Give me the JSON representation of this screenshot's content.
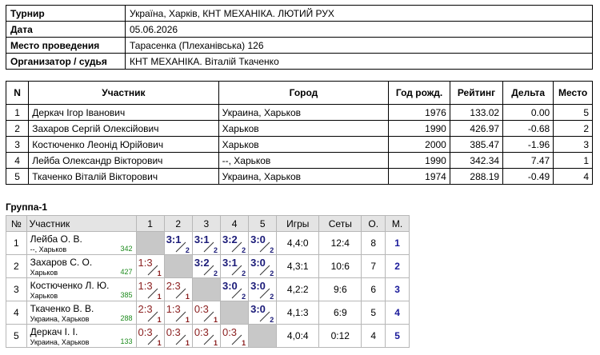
{
  "info": [
    {
      "label": "Турнир",
      "value": "Україна, Харків, КНТ МЕХАНІКА. ЛЮТИЙ РУХ"
    },
    {
      "label": "Дата",
      "value": "05.06.2026"
    },
    {
      "label": "Место проведения",
      "value": "Тарасенка (Плеханівська) 126"
    },
    {
      "label": "Организатор / судья",
      "value": "КНТ МЕХАНІКА. Віталій Ткаченко"
    }
  ],
  "participants": {
    "headers": [
      "N",
      "Участник",
      "Город",
      "Год рожд.",
      "Рейтинг",
      "Дельта",
      "Место"
    ],
    "rows": [
      [
        "1",
        "Деркач Ігор Іванович",
        "Украина, Харьков",
        "1976",
        "133.02",
        "0.00",
        "5"
      ],
      [
        "2",
        "Захаров Сергій Олексійович",
        "Харьков",
        "1990",
        "426.97",
        "-0.68",
        "2"
      ],
      [
        "3",
        "Костюченко Леонід Юрійович",
        "Харьков",
        "2000",
        "385.47",
        "-1.96",
        "3"
      ],
      [
        "4",
        "Лейба Олександр Вікторович",
        "--, Харьков",
        "1990",
        "342.34",
        "7.47",
        "1"
      ],
      [
        "5",
        "Ткаченко Віталій Вікторович",
        "Украина, Харьков",
        "1974",
        "288.19",
        "-0.49",
        "4"
      ]
    ]
  },
  "group": {
    "title": "Группа-1",
    "headers": [
      "№",
      "Участник",
      "1",
      "2",
      "3",
      "4",
      "5",
      "Игры",
      "Сеты",
      "О.",
      "М."
    ],
    "rows": [
      {
        "n": "1",
        "name": "Лейба О. В.",
        "city": "--, Харьков",
        "rating": "342",
        "results": [
          null,
          {
            "s": "3:1",
            "p": "2",
            "w": true
          },
          {
            "s": "3:1",
            "p": "2",
            "w": true
          },
          {
            "s": "3:2",
            "p": "2",
            "w": true
          },
          {
            "s": "3:0",
            "p": "2",
            "w": true
          }
        ],
        "games": "4,4:0",
        "sets": "12:4",
        "points": "8",
        "place": "1"
      },
      {
        "n": "2",
        "name": "Захаров С. О.",
        "city": "Харьков",
        "rating": "427",
        "results": [
          {
            "s": "1:3",
            "p": "1",
            "w": false
          },
          null,
          {
            "s": "3:2",
            "p": "2",
            "w": true
          },
          {
            "s": "3:1",
            "p": "2",
            "w": true
          },
          {
            "s": "3:0",
            "p": "2",
            "w": true
          }
        ],
        "games": "4,3:1",
        "sets": "10:6",
        "points": "7",
        "place": "2"
      },
      {
        "n": "3",
        "name": "Костюченко Л. Ю.",
        "city": "Харьков",
        "rating": "385",
        "results": [
          {
            "s": "1:3",
            "p": "1",
            "w": false
          },
          {
            "s": "2:3",
            "p": "1",
            "w": false
          },
          null,
          {
            "s": "3:0",
            "p": "2",
            "w": true
          },
          {
            "s": "3:0",
            "p": "2",
            "w": true
          }
        ],
        "games": "4,2:2",
        "sets": "9:6",
        "points": "6",
        "place": "3"
      },
      {
        "n": "4",
        "name": "Ткаченко В. В.",
        "city": "Украина, Харьков",
        "rating": "288",
        "results": [
          {
            "s": "2:3",
            "p": "1",
            "w": false
          },
          {
            "s": "1:3",
            "p": "1",
            "w": false
          },
          {
            "s": "0:3",
            "p": "1",
            "w": false
          },
          null,
          {
            "s": "3:0",
            "p": "2",
            "w": true
          }
        ],
        "games": "4,1:3",
        "sets": "6:9",
        "points": "5",
        "place": "4"
      },
      {
        "n": "5",
        "name": "Деркач І. І.",
        "city": "Украина, Харьков",
        "rating": "133",
        "results": [
          {
            "s": "0:3",
            "p": "1",
            "w": false
          },
          {
            "s": "0:3",
            "p": "1",
            "w": false
          },
          {
            "s": "0:3",
            "p": "1",
            "w": false
          },
          {
            "s": "0:3",
            "p": "1",
            "w": false
          },
          null
        ],
        "games": "4,0:4",
        "sets": "0:12",
        "points": "4",
        "place": "5"
      }
    ]
  }
}
